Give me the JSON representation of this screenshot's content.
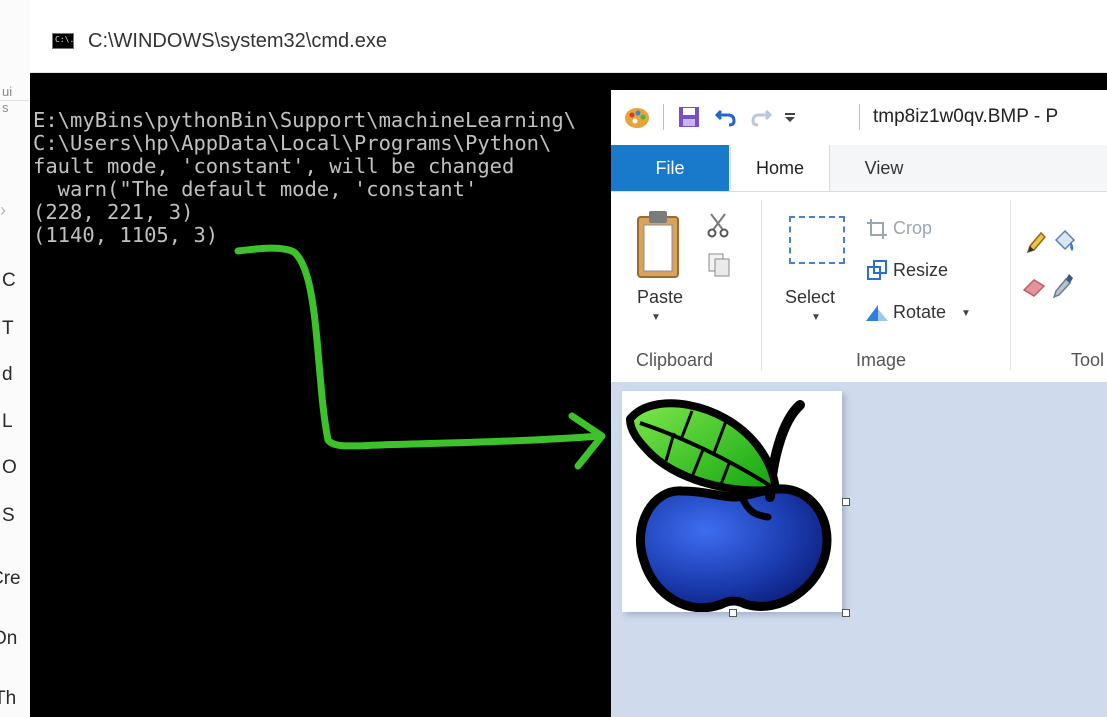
{
  "background_app": {
    "left_fragments": [
      "ui",
      "s",
      "C",
      "T",
      "d",
      "L",
      "O",
      "S",
      "Cre",
      "On",
      "Th"
    ]
  },
  "cmd": {
    "title": "C:\\WINDOWS\\system32\\cmd.exe",
    "icon_text": "C:\\.",
    "output_lines": [
      "E:\\myBins\\pythonBin\\Support\\machineLearning\\",
      "C:\\Users\\hp\\AppData\\Local\\Programs\\Python\\",
      "fault mode, 'constant', will be changed",
      "  warn(\"The default mode, 'constant'",
      "(228, 221, 3)",
      "(1140, 1105, 3)"
    ]
  },
  "paint": {
    "title": "tmp8iz1w0qv.BMP - P",
    "tabs": {
      "file": "File",
      "home": "Home",
      "view": "View"
    },
    "ribbon": {
      "clipboard": {
        "paste": "Paste",
        "group_label": "Clipboard"
      },
      "image": {
        "select": "Select",
        "crop": "Crop",
        "resize": "Resize",
        "rotate": "Rotate",
        "group_label": "Image"
      },
      "tools": {
        "group_label": "Tool"
      }
    }
  },
  "colors": {
    "annotation_green": "#3ec22c",
    "file_tab": "#1979ca",
    "apple_blue": "#1e3fb0",
    "leaf_green": "#38d21c"
  }
}
